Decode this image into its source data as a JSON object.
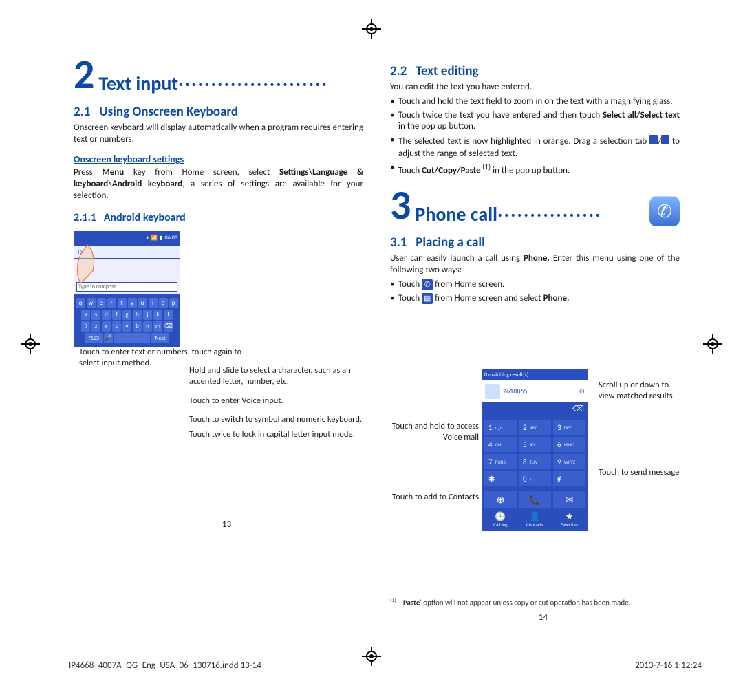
{
  "left": {
    "chapter_num": "2",
    "chapter_title": "Text input",
    "sec21_num": "2.1",
    "sec21_title": "Using Onscreen Keyboard",
    "sec21_body": "Onscreen keyboard will display automatically when a program requires entering text or numbers.",
    "h_settings": "Onscreen keyboard settings",
    "settings_body_a": "Press ",
    "settings_body_menu": "Menu",
    "settings_body_b": " key from Home screen, select ",
    "settings_body_path": "Settings\\Language & keyboard\\Android keyboard",
    "settings_body_c": ", a series of settings are available for your selection.",
    "sec211_num": "2.1.1",
    "sec211_title": "Android keyboard",
    "kb_caption1": "Touch to enter text or numbers, touch again to select input method.",
    "kb_callout_hold": "Hold and slide to select a character, such as an accented letter, number, etc.",
    "kb_callout_voice": "Touch to enter Voice input.",
    "kb_callout_sym": "Touch to switch to symbol and numeric keyboard.",
    "kb_callout_caps": "Touch twice to lock in capital letter input mode.",
    "kb": {
      "to": "To",
      "compose": "Type to compose",
      "row1": [
        "q",
        "w",
        "e",
        "r",
        "t",
        "y",
        "u",
        "i",
        "o",
        "p"
      ],
      "row2": [
        "a",
        "s",
        "d",
        "f",
        "g",
        "h",
        "j",
        "k",
        "l"
      ],
      "row3": [
        "⇧",
        "z",
        "x",
        "c",
        "v",
        "b",
        "n",
        "m",
        "⌫"
      ],
      "row4_sym": "?123",
      "row4_next": "Next"
    },
    "pagenum": "13"
  },
  "right": {
    "sec22_num": "2.2",
    "sec22_title": "Text editing",
    "sec22_intro": "You can edit the text you have entered.",
    "b1": "Touch and hold the text field to zoom in on the text with a magnifying glass.",
    "b2a": "Touch twice the text you have entered and then touch ",
    "b2b": "Select all/Select text",
    "b2c": " in the pop up button.",
    "b3a": "The selected text is now highlighted in orange. Drag a selection tab ",
    "b3b": " to adjust the range of selected text.",
    "b4a": "Touch ",
    "b4b": "Cut/Copy/Paste",
    "b4sup": " (1)",
    "b4c": " in the pop up button.",
    "chapter3_num": "3",
    "chapter3_title": "Phone call",
    "sec31_num": "3.1",
    "sec31_title": "Placing a call",
    "sec31_body_a": "User can easily launch a call using ",
    "sec31_body_phone": "Phone.",
    "sec31_body_b": " Enter this menu using one of the following two ways:",
    "p1a": "Touch ",
    "p1b": " from Home screen.",
    "p2a": "Touch ",
    "p2b": " from Home screen and select ",
    "p2c": "Phone.",
    "dial_left1": "Touch and hold to access Voice mail",
    "dial_left2": "Touch to add to Contacts",
    "dial_right1": "Scroll up or down to view matched results",
    "dial_right2": "Touch to send message",
    "dialer": {
      "matching": "0 matching result(s)",
      "number": "2618865",
      "keys": [
        [
          "1",
          "o_o"
        ],
        [
          "2",
          "ABC"
        ],
        [
          "3",
          "DEF"
        ],
        [
          "4",
          "GHI"
        ],
        [
          "5",
          "JKL"
        ],
        [
          "6",
          "MNO"
        ],
        [
          "7",
          "PQRS"
        ],
        [
          "8",
          "TUV"
        ],
        [
          "9",
          "WXYZ"
        ],
        [
          "✱",
          ""
        ],
        [
          "0",
          "+"
        ],
        [
          "#",
          ""
        ]
      ],
      "tabs": [
        "Call log",
        "Contacts",
        "Favorites"
      ]
    },
    "footnote_mark": "(1)",
    "footnote_a": "'",
    "footnote_b": "Paste",
    "footnote_c": "' option will not appear unless copy or cut operation has been made.",
    "pagenum": "14"
  },
  "slug": {
    "file": "IP4668_4007A_QG_Eng_USA_06_130716.indd   13-14",
    "date": "2013-7-16    1:12:24"
  }
}
